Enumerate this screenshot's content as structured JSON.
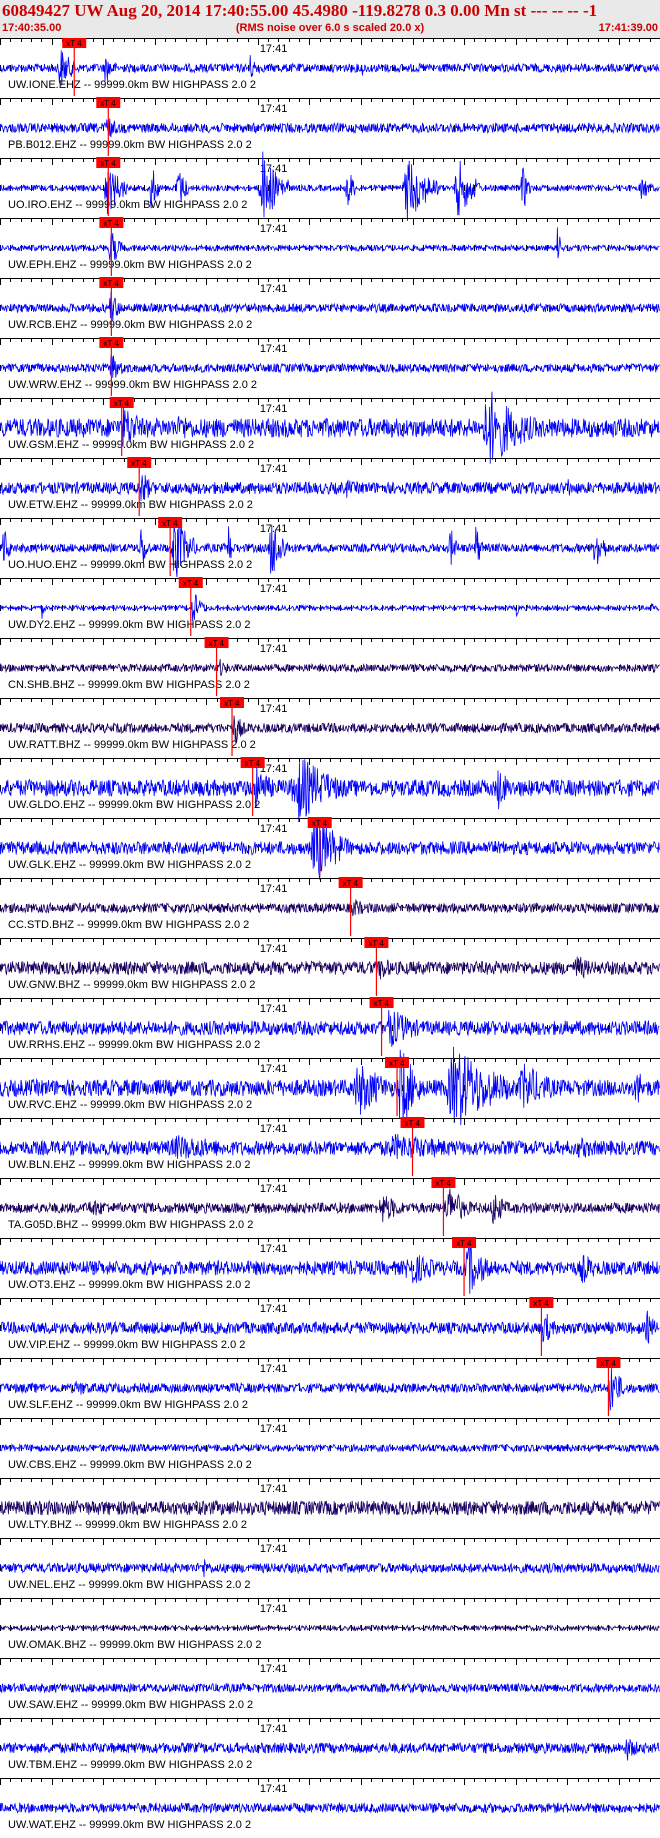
{
  "header": {
    "title": "60849427 UW Aug 20, 2014 17:40:55.00   45.4980 -119.8278  0.3 0.00 Mn st --- -- --   -1",
    "start_time": "17:40:35.00",
    "rms_note": "(RMS noise over 6.0 s scaled 20.0 x)",
    "end_time": "17:41:39.00"
  },
  "colors": {
    "trace_blue": "#0000ff",
    "trace_dark": "#1a0066",
    "pick": "#ff0000",
    "pick_box": "#ff0000",
    "header_bg": "#e9e9e9",
    "header_text": "#cc0000",
    "grid": "#000000"
  },
  "chart_data": {
    "type": "line",
    "x_unit": "seconds",
    "time_start": "17:40:35.00",
    "time_end": "17:41:39.00",
    "minute_mark_label": "17:41",
    "minute_mark_seconds": 25,
    "tick_interval_seconds": 1,
    "pick_label": "xT 4",
    "channels": [
      {
        "label": "UW.IONE.EHZ -- 99999.0km BW  HIGHPASS  2.0  2",
        "pick_s": 7.2,
        "noise": 0.18,
        "color": "blue",
        "bursts": [
          [
            5.5,
            7.5,
            1.0
          ],
          [
            10.0,
            11.5,
            0.7
          ],
          [
            24.0,
            25.5,
            0.6
          ],
          [
            35,
            36,
            0.35
          ]
        ]
      },
      {
        "label": "PB.B012.EHZ -- 99999.0km BW  HIGHPASS  2.0  2",
        "pick_s": 10.5,
        "noise": 0.2,
        "color": "blue",
        "bursts": [
          [
            10.0,
            12.0,
            0.6
          ]
        ]
      },
      {
        "label": "UO.IRO.EHZ -- 99999.0km BW  HIGHPASS  2.0  2",
        "pick_s": 10.5,
        "noise": 0.12,
        "color": "blue",
        "bursts": [
          [
            10.0,
            12.5,
            1.2
          ],
          [
            14.5,
            15.5,
            1.2
          ],
          [
            17.0,
            18.5,
            1.0
          ],
          [
            25.0,
            28.0,
            1.6
          ],
          [
            33.5,
            34.5,
            1.2
          ],
          [
            39.0,
            42.5,
            1.5
          ],
          [
            44.0,
            46.5,
            1.4
          ],
          [
            50.5,
            51.5,
            1.2
          ],
          [
            62,
            63.5,
            0.6
          ]
        ]
      },
      {
        "label": "UW.EPH.EHZ -- 99999.0km BW  HIGHPASS  2.0  2",
        "pick_s": 10.8,
        "noise": 0.12,
        "color": "blue",
        "bursts": [
          [
            10.5,
            12.0,
            0.9
          ],
          [
            54.0,
            54.4,
            1.5
          ]
        ]
      },
      {
        "label": "UW.RCB.EHZ -- 99999.0km BW  HIGHPASS  2.0  2",
        "pick_s": 10.8,
        "noise": 0.18,
        "color": "blue",
        "bursts": [
          [
            10.5,
            12.0,
            0.8
          ]
        ]
      },
      {
        "label": "UW.WRW.EHZ -- 99999.0km BW  HIGHPASS  2.0  2",
        "pick_s": 10.8,
        "noise": 0.18,
        "color": "blue",
        "bursts": [
          [
            10.5,
            12.5,
            0.7
          ]
        ]
      },
      {
        "label": "UW.GSM.EHZ -- 99999.0km BW  HIGHPASS  2.0  2",
        "pick_s": 11.8,
        "noise": 0.4,
        "color": "blue",
        "bursts": [
          [
            11.5,
            15.0,
            1.0
          ],
          [
            17.0,
            20.0,
            0.7
          ],
          [
            46.5,
            52.5,
            1.7
          ]
        ]
      },
      {
        "label": "UW.ETW.EHZ -- 99999.0km BW  HIGHPASS  2.0  2",
        "pick_s": 13.5,
        "noise": 0.25,
        "color": "blue",
        "bursts": [
          [
            13.5,
            15.0,
            0.9
          ],
          [
            33.5,
            34.5,
            0.5
          ],
          [
            55,
            55.6,
            0.6
          ]
        ]
      },
      {
        "label": "UO.HUO.EHZ -- 99999.0km BW  HIGHPASS  2.0  2",
        "pick_s": 16.5,
        "noise": 0.18,
        "color": "blue",
        "bursts": [
          [
            0.2,
            1.2,
            1.0
          ],
          [
            13.5,
            14.5,
            1.2
          ],
          [
            16.5,
            19.0,
            1.6
          ],
          [
            22.0,
            22.7,
            1.2
          ],
          [
            26.0,
            28.0,
            1.5
          ],
          [
            43.5,
            44.5,
            1.0
          ],
          [
            46.0,
            46.8,
            1.2
          ],
          [
            57.5,
            59.0,
            1.2
          ]
        ]
      },
      {
        "label": "UW.DY2.EHZ -- 99999.0km BW  HIGHPASS  2.0  2",
        "pick_s": 18.5,
        "noise": 0.1,
        "color": "blue",
        "bursts": [
          [
            18.5,
            20.0,
            0.8
          ],
          [
            4.0,
            4.4,
            0.5
          ],
          [
            50,
            50.5,
            0.4
          ],
          [
            63,
            63.6,
            0.4
          ]
        ]
      },
      {
        "label": "CN.SHB.BHZ -- 99999.0km BW  HIGHPASS  2.0  2",
        "pick_s": 21.0,
        "noise": 0.16,
        "color": "dark",
        "bursts": [
          [
            21.0,
            23.0,
            0.4
          ]
        ]
      },
      {
        "label": "UW.RATT.BHZ -- 99999.0km BW  HIGHPASS  2.0  2",
        "pick_s": 22.5,
        "noise": 0.2,
        "color": "dark",
        "bursts": [
          [
            22.5,
            24.0,
            0.8
          ]
        ]
      },
      {
        "label": "UW.GLDO.EHZ -- 99999.0km BW  HIGHPASS  2.0  2",
        "pick_s": 24.5,
        "noise": 0.35,
        "color": "blue",
        "bursts": [
          [
            24.5,
            27.0,
            1.1
          ],
          [
            28.0,
            34.0,
            1.5
          ],
          [
            48.0,
            50.0,
            1.0
          ]
        ]
      },
      {
        "label": "UW.GLK.EHZ -- 99999.0km BW  HIGHPASS  2.0  2",
        "pick_s": 31.0,
        "noise": 0.28,
        "color": "blue",
        "bursts": [
          [
            30.0,
            34.0,
            1.6
          ]
        ]
      },
      {
        "label": "CC.STD.BHZ -- 99999.0km BW  HIGHPASS  2.0  2",
        "pick_s": 34.0,
        "noise": 0.2,
        "color": "dark",
        "bursts": [
          [
            34.0,
            36.0,
            0.5
          ]
        ]
      },
      {
        "label": "UW.GNW.BHZ -- 99999.0km BW  HIGHPASS  2.0  2",
        "pick_s": 36.5,
        "noise": 0.28,
        "color": "dark",
        "bursts": [
          [
            36.5,
            39.0,
            0.6
          ],
          [
            55.5,
            58.5,
            0.6
          ]
        ]
      },
      {
        "label": "UW.RRHS.EHZ -- 99999.0km BW  HIGHPASS  2.0  2",
        "pick_s": 37.0,
        "noise": 0.3,
        "color": "blue",
        "bursts": [
          [
            37.0,
            42.0,
            0.9
          ]
        ]
      },
      {
        "label": "UW.RVC.EHZ -- 99999.0km BW  HIGHPASS  2.0  2",
        "pick_s": 38.5,
        "noise": 0.35,
        "color": "blue",
        "bursts": [
          [
            34.0,
            39.0,
            1.2
          ],
          [
            38.5,
            41.0,
            2.0
          ],
          [
            43.0,
            50.0,
            1.9
          ],
          [
            50.0,
            55.0,
            1.1
          ],
          [
            61.5,
            63.0,
            1.0
          ]
        ]
      },
      {
        "label": "UW.BLN.EHZ -- 99999.0km BW  HIGHPASS  2.0  2",
        "pick_s": 40.0,
        "noise": 0.3,
        "color": "blue",
        "bursts": [
          [
            15.0,
            30.0,
            0.55
          ],
          [
            36.0,
            52.0,
            0.6
          ],
          [
            55.0,
            63.0,
            0.45
          ]
        ]
      },
      {
        "label": "TA.G05D.BHZ -- 99999.0km BW  HIGHPASS  2.0  2",
        "pick_s": 43.0,
        "noise": 0.22,
        "color": "dark",
        "bursts": [
          [
            8.0,
            14.0,
            0.4
          ],
          [
            36.5,
            40.0,
            0.7
          ],
          [
            43.0,
            46.0,
            1.0
          ],
          [
            47.5,
            49.5,
            0.9
          ]
        ]
      },
      {
        "label": "UW.OT3.EHZ -- 99999.0km BW  HIGHPASS  2.0  2",
        "pick_s": 45.0,
        "noise": 0.3,
        "color": "blue",
        "bursts": [
          [
            39.0,
            44.0,
            0.8
          ],
          [
            45.0,
            48.0,
            1.2
          ],
          [
            56.0,
            59.0,
            0.7
          ]
        ]
      },
      {
        "label": "UW.VIP.EHZ -- 99999.0km BW  HIGHPASS  2.0  2",
        "pick_s": 52.5,
        "noise": 0.25,
        "color": "blue",
        "bursts": [
          [
            52.5,
            54.0,
            0.9
          ],
          [
            62.5,
            64.0,
            0.8
          ]
        ]
      },
      {
        "label": "UW.SLF.EHZ -- 99999.0km BW  HIGHPASS  2.0  2",
        "pick_s": 59.0,
        "noise": 0.2,
        "color": "blue",
        "bursts": [
          [
            7.0,
            10.0,
            0.4
          ],
          [
            59.0,
            60.5,
            1.4
          ]
        ]
      },
      {
        "label": "UW.CBS.EHZ -- 99999.0km BW  HIGHPASS  2.0  2",
        "pick_s": null,
        "noise": 0.15,
        "color": "blue",
        "bursts": []
      },
      {
        "label": "UW.LTY.BHZ -- 99999.0km BW  HIGHPASS  2.0  2",
        "pick_s": null,
        "noise": 0.3,
        "color": "dark",
        "bursts": [
          [
            17.0,
            28.0,
            0.35
          ]
        ]
      },
      {
        "label": "UW.NEL.EHZ -- 99999.0km BW  HIGHPASS  2.0  2",
        "pick_s": null,
        "noise": 0.2,
        "color": "blue",
        "bursts": [
          [
            19.5,
            21.0,
            0.5
          ]
        ]
      },
      {
        "label": "UW.OMAK.BHZ -- 99999.0km BW  HIGHPASS  2.0  2",
        "pick_s": null,
        "noise": 0.1,
        "color": "dark",
        "bursts": []
      },
      {
        "label": "UW.SAW.EHZ -- 99999.0km BW  HIGHPASS  2.0  2",
        "pick_s": null,
        "noise": 0.18,
        "color": "blue",
        "bursts": []
      },
      {
        "label": "UW.TBM.EHZ -- 99999.0km BW  HIGHPASS  2.0  2",
        "pick_s": null,
        "noise": 0.22,
        "color": "blue",
        "bursts": [
          [
            60.5,
            62.5,
            0.6
          ]
        ]
      },
      {
        "label": "UW.WAT.EHZ -- 99999.0km BW  HIGHPASS  2.0  2",
        "pick_s": null,
        "noise": 0.2,
        "color": "blue",
        "bursts": []
      }
    ]
  }
}
